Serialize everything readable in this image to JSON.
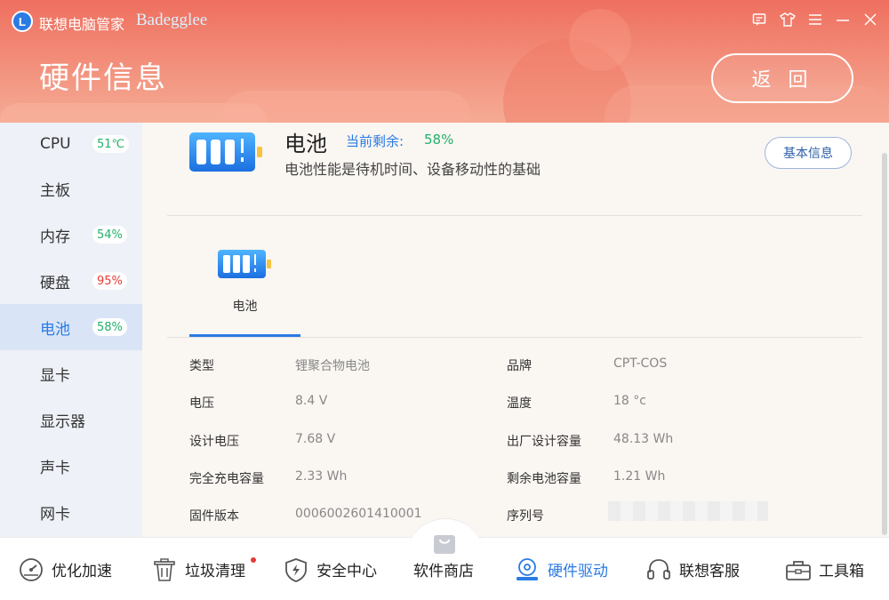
{
  "app": {
    "logo_letter": "L",
    "title": "联想电脑管家",
    "brand": "Badegglee"
  },
  "window_controls": [
    {
      "name": "feedback-icon",
      "glyph": "▭"
    },
    {
      "name": "skin-icon",
      "glyph": "⛉"
    },
    {
      "name": "menu-icon",
      "glyph": "≡"
    },
    {
      "name": "minimize-icon",
      "glyph": "—"
    },
    {
      "name": "close-icon",
      "glyph": "✕"
    }
  ],
  "header": {
    "page_title": "硬件信息",
    "back_label": "返 回"
  },
  "sidebar": {
    "items": [
      {
        "label": "CPU",
        "badge": "51℃",
        "badge_color": "green"
      },
      {
        "label": "主板",
        "badge": ""
      },
      {
        "label": "内存",
        "badge": "54%",
        "badge_color": "green"
      },
      {
        "label": "硬盘",
        "badge": "95%",
        "badge_color": "red"
      },
      {
        "label": "电池",
        "badge": "58%",
        "badge_color": "green",
        "active": true
      },
      {
        "label": "显卡",
        "badge": ""
      },
      {
        "label": "显示器",
        "badge": ""
      },
      {
        "label": "声卡",
        "badge": ""
      },
      {
        "label": "网卡",
        "badge": ""
      }
    ]
  },
  "device": {
    "title": "电池",
    "remaining_label": "当前剩余:",
    "remaining_value": "58%",
    "description": "电池性能是待机时间、设备移动性的基础",
    "basic_info_label": "基本信息",
    "tab_label": "电池"
  },
  "specs": {
    "left": [
      {
        "label": "类型",
        "value": "锂聚合物电池"
      },
      {
        "label": "电压",
        "value": "8.4 V"
      },
      {
        "label": "设计电压",
        "value": "7.68 V"
      },
      {
        "label": "完全充电容量",
        "value": "2.33 Wh"
      },
      {
        "label": "固件版本",
        "value": "0006002601410001"
      }
    ],
    "right": [
      {
        "label": "品牌",
        "value": "CPT-COS"
      },
      {
        "label": "温度",
        "value": "18 °c"
      },
      {
        "label": "出厂设计容量",
        "value": "48.13 Wh"
      },
      {
        "label": "剩余电池容量",
        "value": "1.21 Wh"
      },
      {
        "label": "序列号",
        "value": ""
      }
    ]
  },
  "bottom_nav": [
    {
      "label": "优化加速",
      "icon": "speedometer-icon"
    },
    {
      "label": "垃圾清理",
      "icon": "trash-icon",
      "dot": true
    },
    {
      "label": "安全中心",
      "icon": "shield-icon"
    },
    {
      "label": "软件商店",
      "icon": "bag-icon"
    },
    {
      "label": "硬件驱动",
      "icon": "hardware-icon",
      "active": true
    },
    {
      "label": "联想客服",
      "icon": "headset-icon"
    },
    {
      "label": "工具箱",
      "icon": "toolbox-icon"
    }
  ],
  "colors": {
    "accent": "#2a7be4",
    "green": "#22b06a",
    "red": "#e63a35",
    "header": "#ef6f5f"
  }
}
